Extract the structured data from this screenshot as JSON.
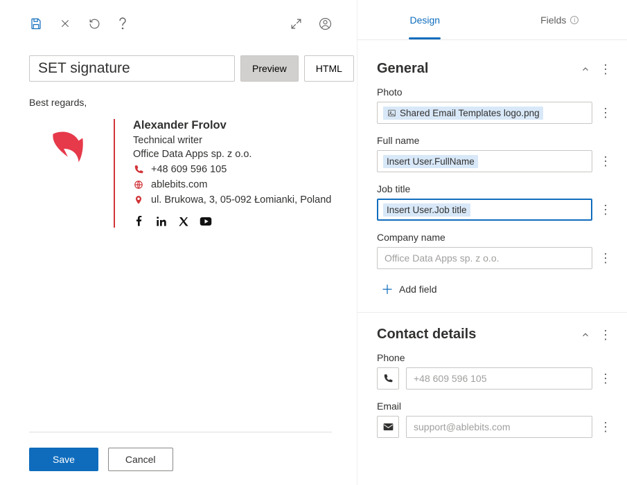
{
  "toolbar": {
    "signature_name": "SET signature",
    "preview_label": "Preview",
    "html_label": "HTML"
  },
  "preview": {
    "greeting": "Best regards,",
    "full_name": "Alexander Frolov",
    "job_title": "Technical writer",
    "company": "Office Data Apps sp. z o.o.",
    "phone": "+48 609 596 105",
    "website": "ablebits.com",
    "address": "ul. Brukowa, 3, 05-092 Łomianki, Poland"
  },
  "footer": {
    "save_label": "Save",
    "cancel_label": "Cancel"
  },
  "tabs": {
    "design_label": "Design",
    "fields_label": "Fields"
  },
  "sections": {
    "general": {
      "title": "General",
      "photo": {
        "label": "Photo",
        "token": "Shared Email Templates logo.png"
      },
      "full_name": {
        "label": "Full name",
        "token": "Insert User.FullName"
      },
      "job_title": {
        "label": "Job title",
        "token": "Insert User.Job title"
      },
      "company": {
        "label": "Company name",
        "placeholder": "Office Data Apps sp. z o.o."
      },
      "add_field_label": "Add field"
    },
    "contact": {
      "title": "Contact details",
      "phone": {
        "label": "Phone",
        "placeholder": "+48 609 596 105"
      },
      "email": {
        "label": "Email",
        "placeholder": "support@ablebits.com"
      }
    }
  }
}
